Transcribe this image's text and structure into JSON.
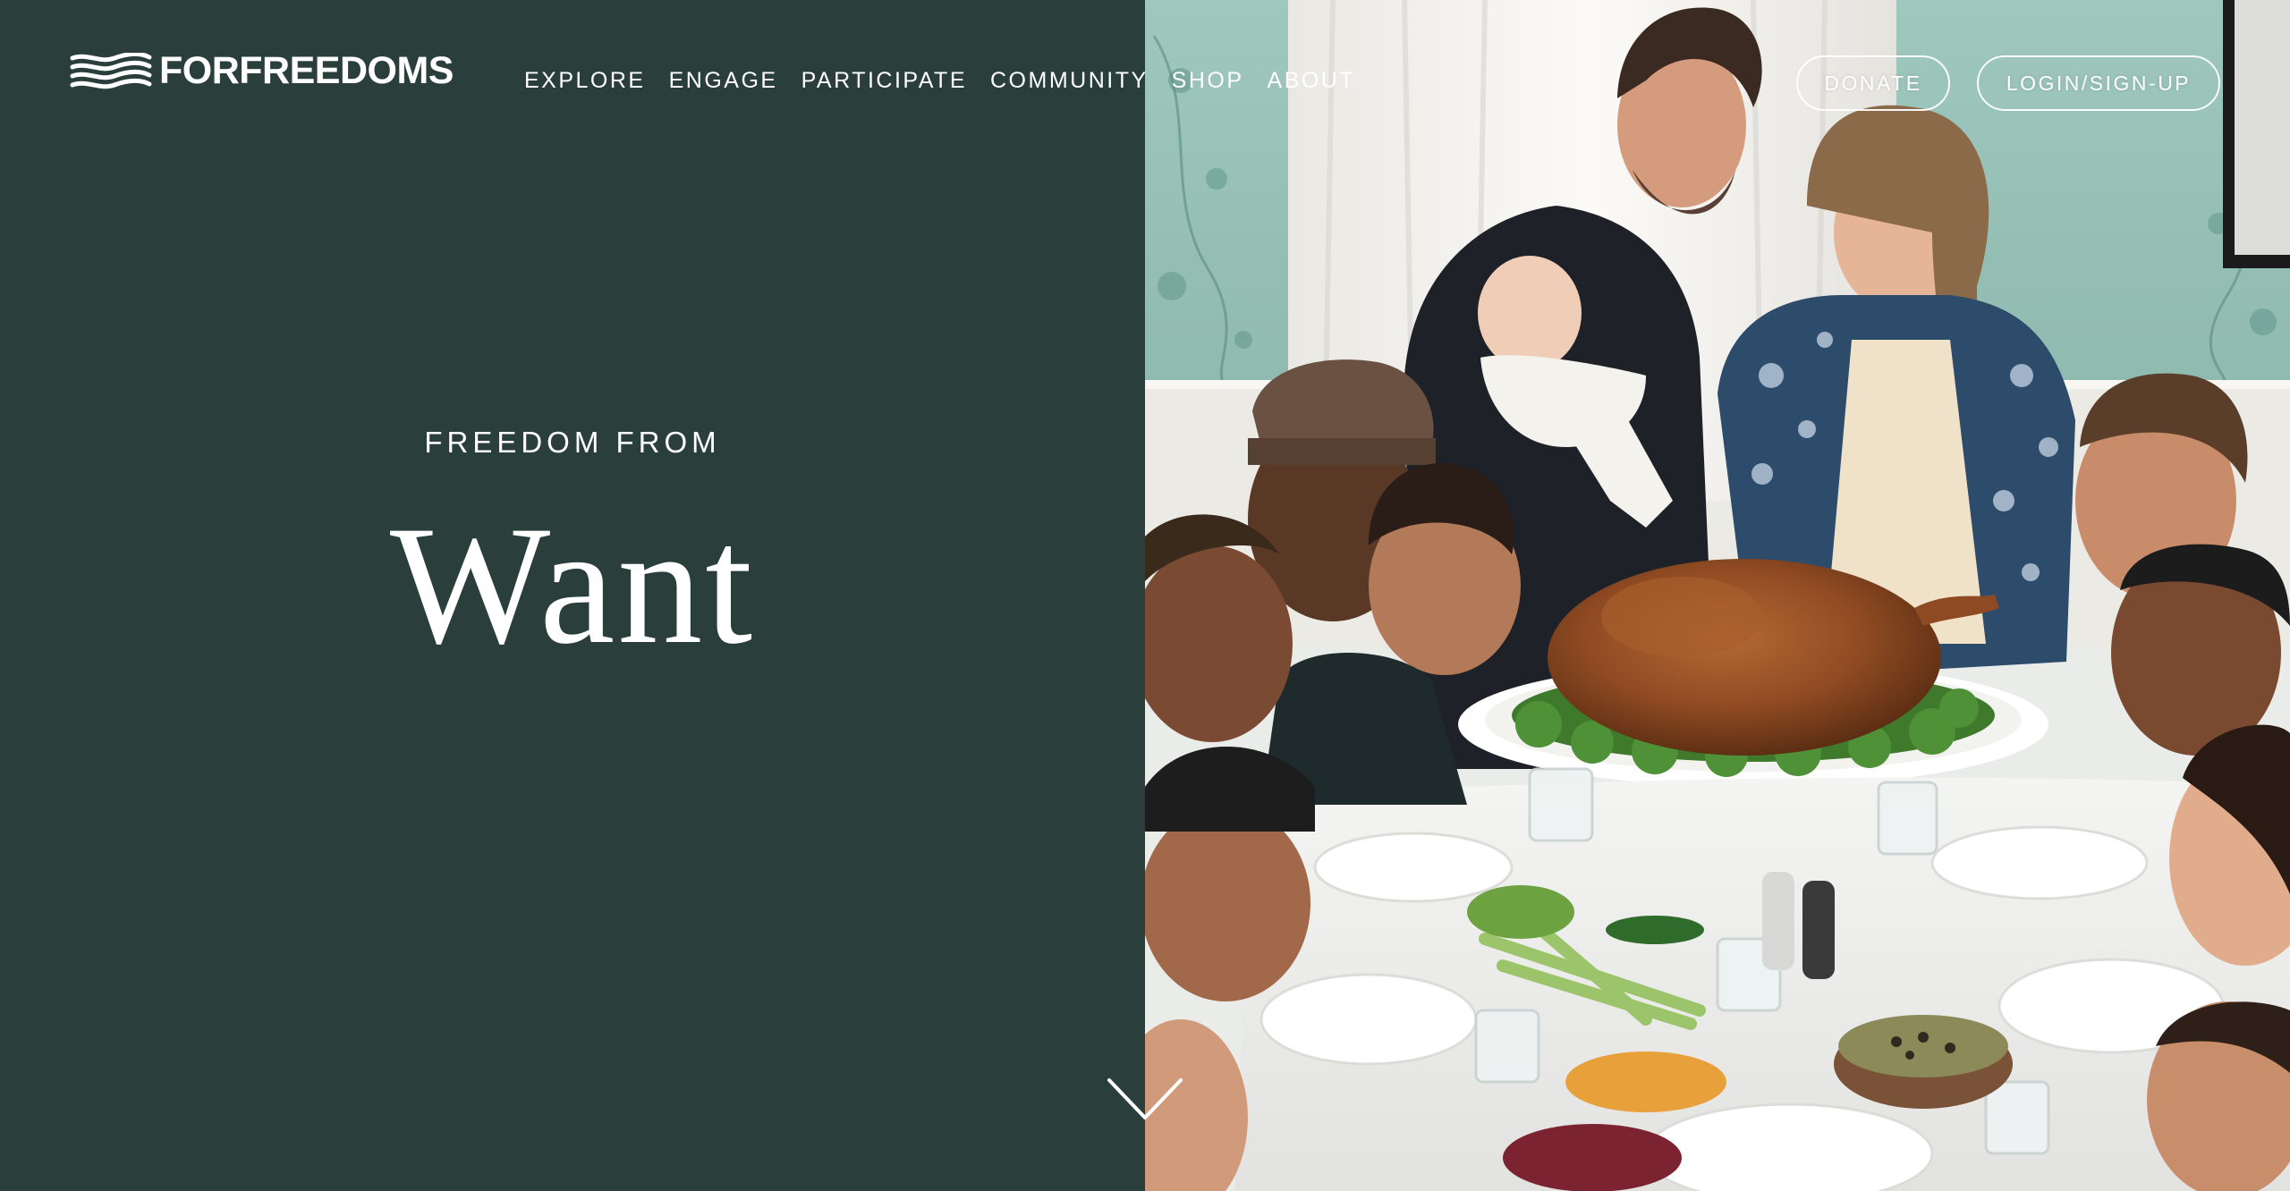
{
  "brand": {
    "logo_text": "FORFREEDOMS",
    "logo_icon": "waving-flag-icon"
  },
  "nav": {
    "items": [
      {
        "label": "EXPLORE"
      },
      {
        "label": "ENGAGE"
      },
      {
        "label": "PARTICIPATE"
      },
      {
        "label": "COMMUNITY"
      },
      {
        "label": "SHOP"
      },
      {
        "label": "ABOUT"
      }
    ]
  },
  "actions": {
    "donate_label": "DONATE",
    "login_label": "LOGIN/SIGN-UP"
  },
  "hero": {
    "eyebrow": "FREEDOM FROM",
    "title": "Want",
    "scroll_icon": "chevron-down-icon",
    "image_subject": "family-thanksgiving-dinner-photo"
  },
  "colors": {
    "panel_background": "#2a3f3b",
    "text": "#ffffff"
  }
}
